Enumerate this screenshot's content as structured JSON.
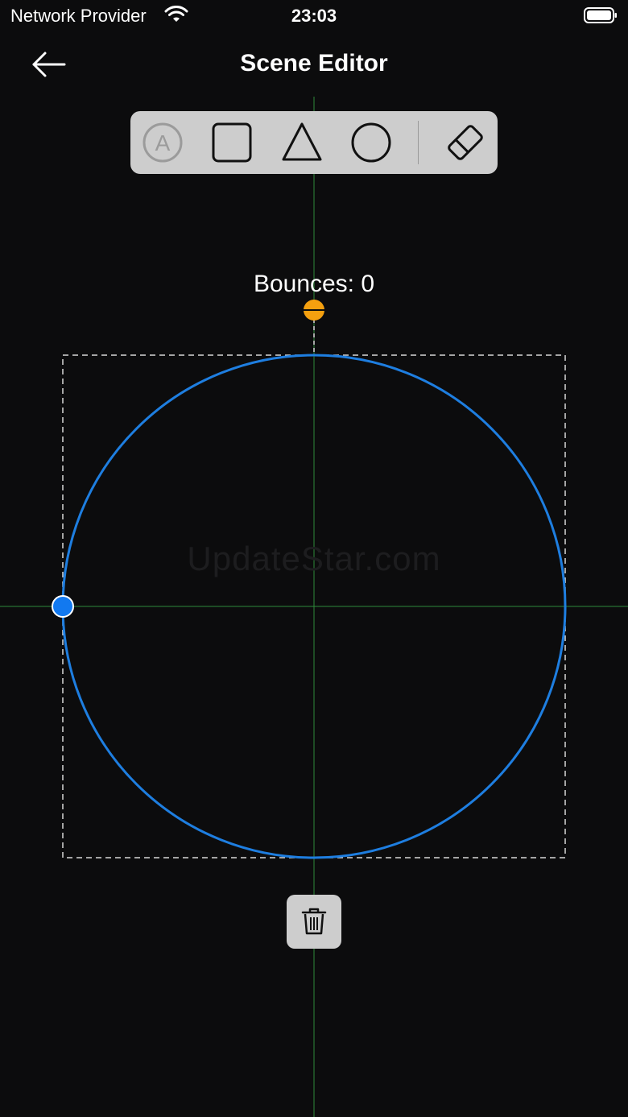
{
  "status_bar": {
    "carrier": "Network Provider",
    "time": "23:03",
    "wifi_icon": "wifi-icon",
    "battery_icon": "battery-full-icon"
  },
  "nav": {
    "title": "Scene Editor",
    "back_icon": "arrow-left-icon"
  },
  "toolbar": {
    "tools": [
      {
        "name": "text",
        "icon": "letter-a-circle-icon",
        "label": "A",
        "enabled": false
      },
      {
        "name": "square",
        "icon": "square-icon",
        "enabled": true
      },
      {
        "name": "triangle",
        "icon": "triangle-icon",
        "enabled": true
      },
      {
        "name": "circle",
        "icon": "circle-icon",
        "enabled": true
      },
      {
        "name": "eraser",
        "icon": "eraser-icon",
        "enabled": true
      }
    ]
  },
  "scene": {
    "bounces_text": "Bounces: 0",
    "watermark": "UpdateStar.com",
    "colors": {
      "circle_stroke": "#1e7ee0",
      "handle": "#1279f0",
      "ball": "#f5a00f",
      "guide_lines": "#2e8a3a",
      "selection_box": "#d8d8d8"
    }
  },
  "delete_icon": "trash-icon"
}
